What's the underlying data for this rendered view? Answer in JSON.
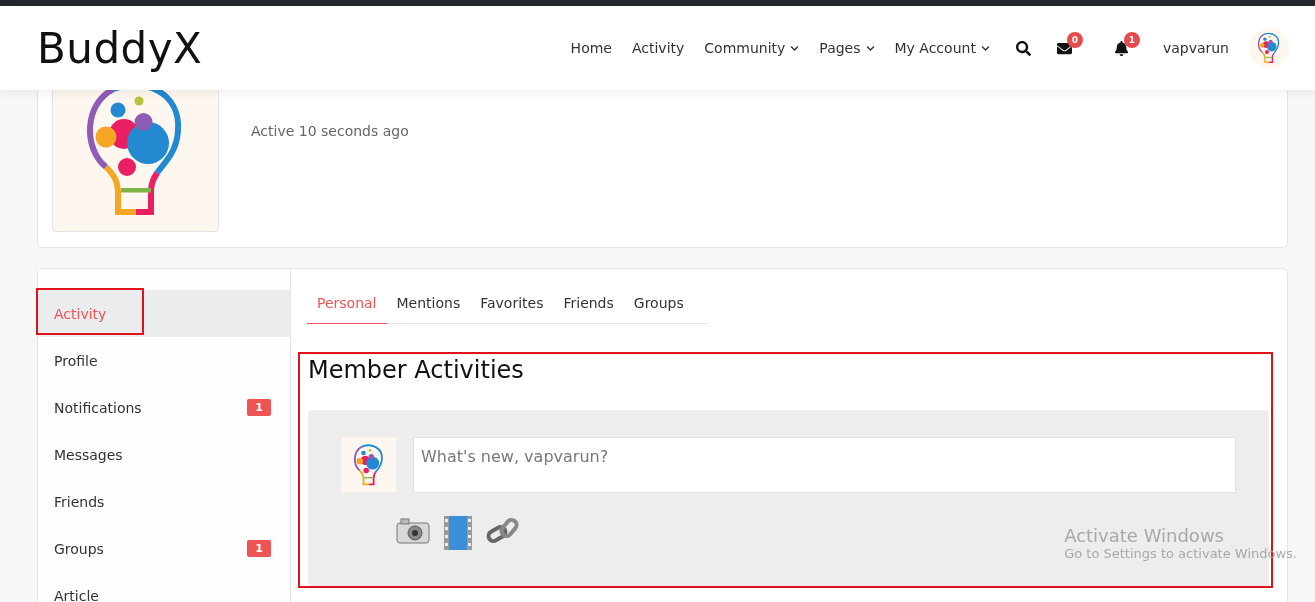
{
  "header": {
    "logo": "BuddyX",
    "nav": [
      {
        "label": "Home",
        "dropdown": false
      },
      {
        "label": "Activity",
        "dropdown": false
      },
      {
        "label": "Community",
        "dropdown": true
      },
      {
        "label": "Pages",
        "dropdown": true
      },
      {
        "label": "My Account",
        "dropdown": true
      }
    ],
    "messages_badge": "0",
    "notifications_badge": "1",
    "username": "vapvarun"
  },
  "profile": {
    "status": "Active 10 seconds ago"
  },
  "sidebar": {
    "items": [
      {
        "label": "Activity",
        "selected": true,
        "highlighted": true
      },
      {
        "label": "Profile",
        "selected": false,
        "highlighted": false
      },
      {
        "label": "Notifications",
        "selected": false,
        "highlighted": false,
        "badge": "1"
      },
      {
        "label": "Messages",
        "selected": false,
        "highlighted": false
      },
      {
        "label": "Friends",
        "selected": false,
        "highlighted": false
      },
      {
        "label": "Groups",
        "selected": false,
        "highlighted": false,
        "badge": "1"
      },
      {
        "label": "Article",
        "selected": false,
        "highlighted": false
      }
    ]
  },
  "tabs": [
    {
      "label": "Personal",
      "selected": true
    },
    {
      "label": "Mentions",
      "selected": false
    },
    {
      "label": "Favorites",
      "selected": false
    },
    {
      "label": "Friends",
      "selected": false
    },
    {
      "label": "Groups",
      "selected": false
    }
  ],
  "activity_section": {
    "title": "Member Activities",
    "highlighted": true,
    "post_box": {
      "placeholder": "What's new, vapvarun?"
    }
  },
  "os_watermark": {
    "title": "Activate Windows",
    "subtitle": "Go to Settings to activate Windows."
  }
}
